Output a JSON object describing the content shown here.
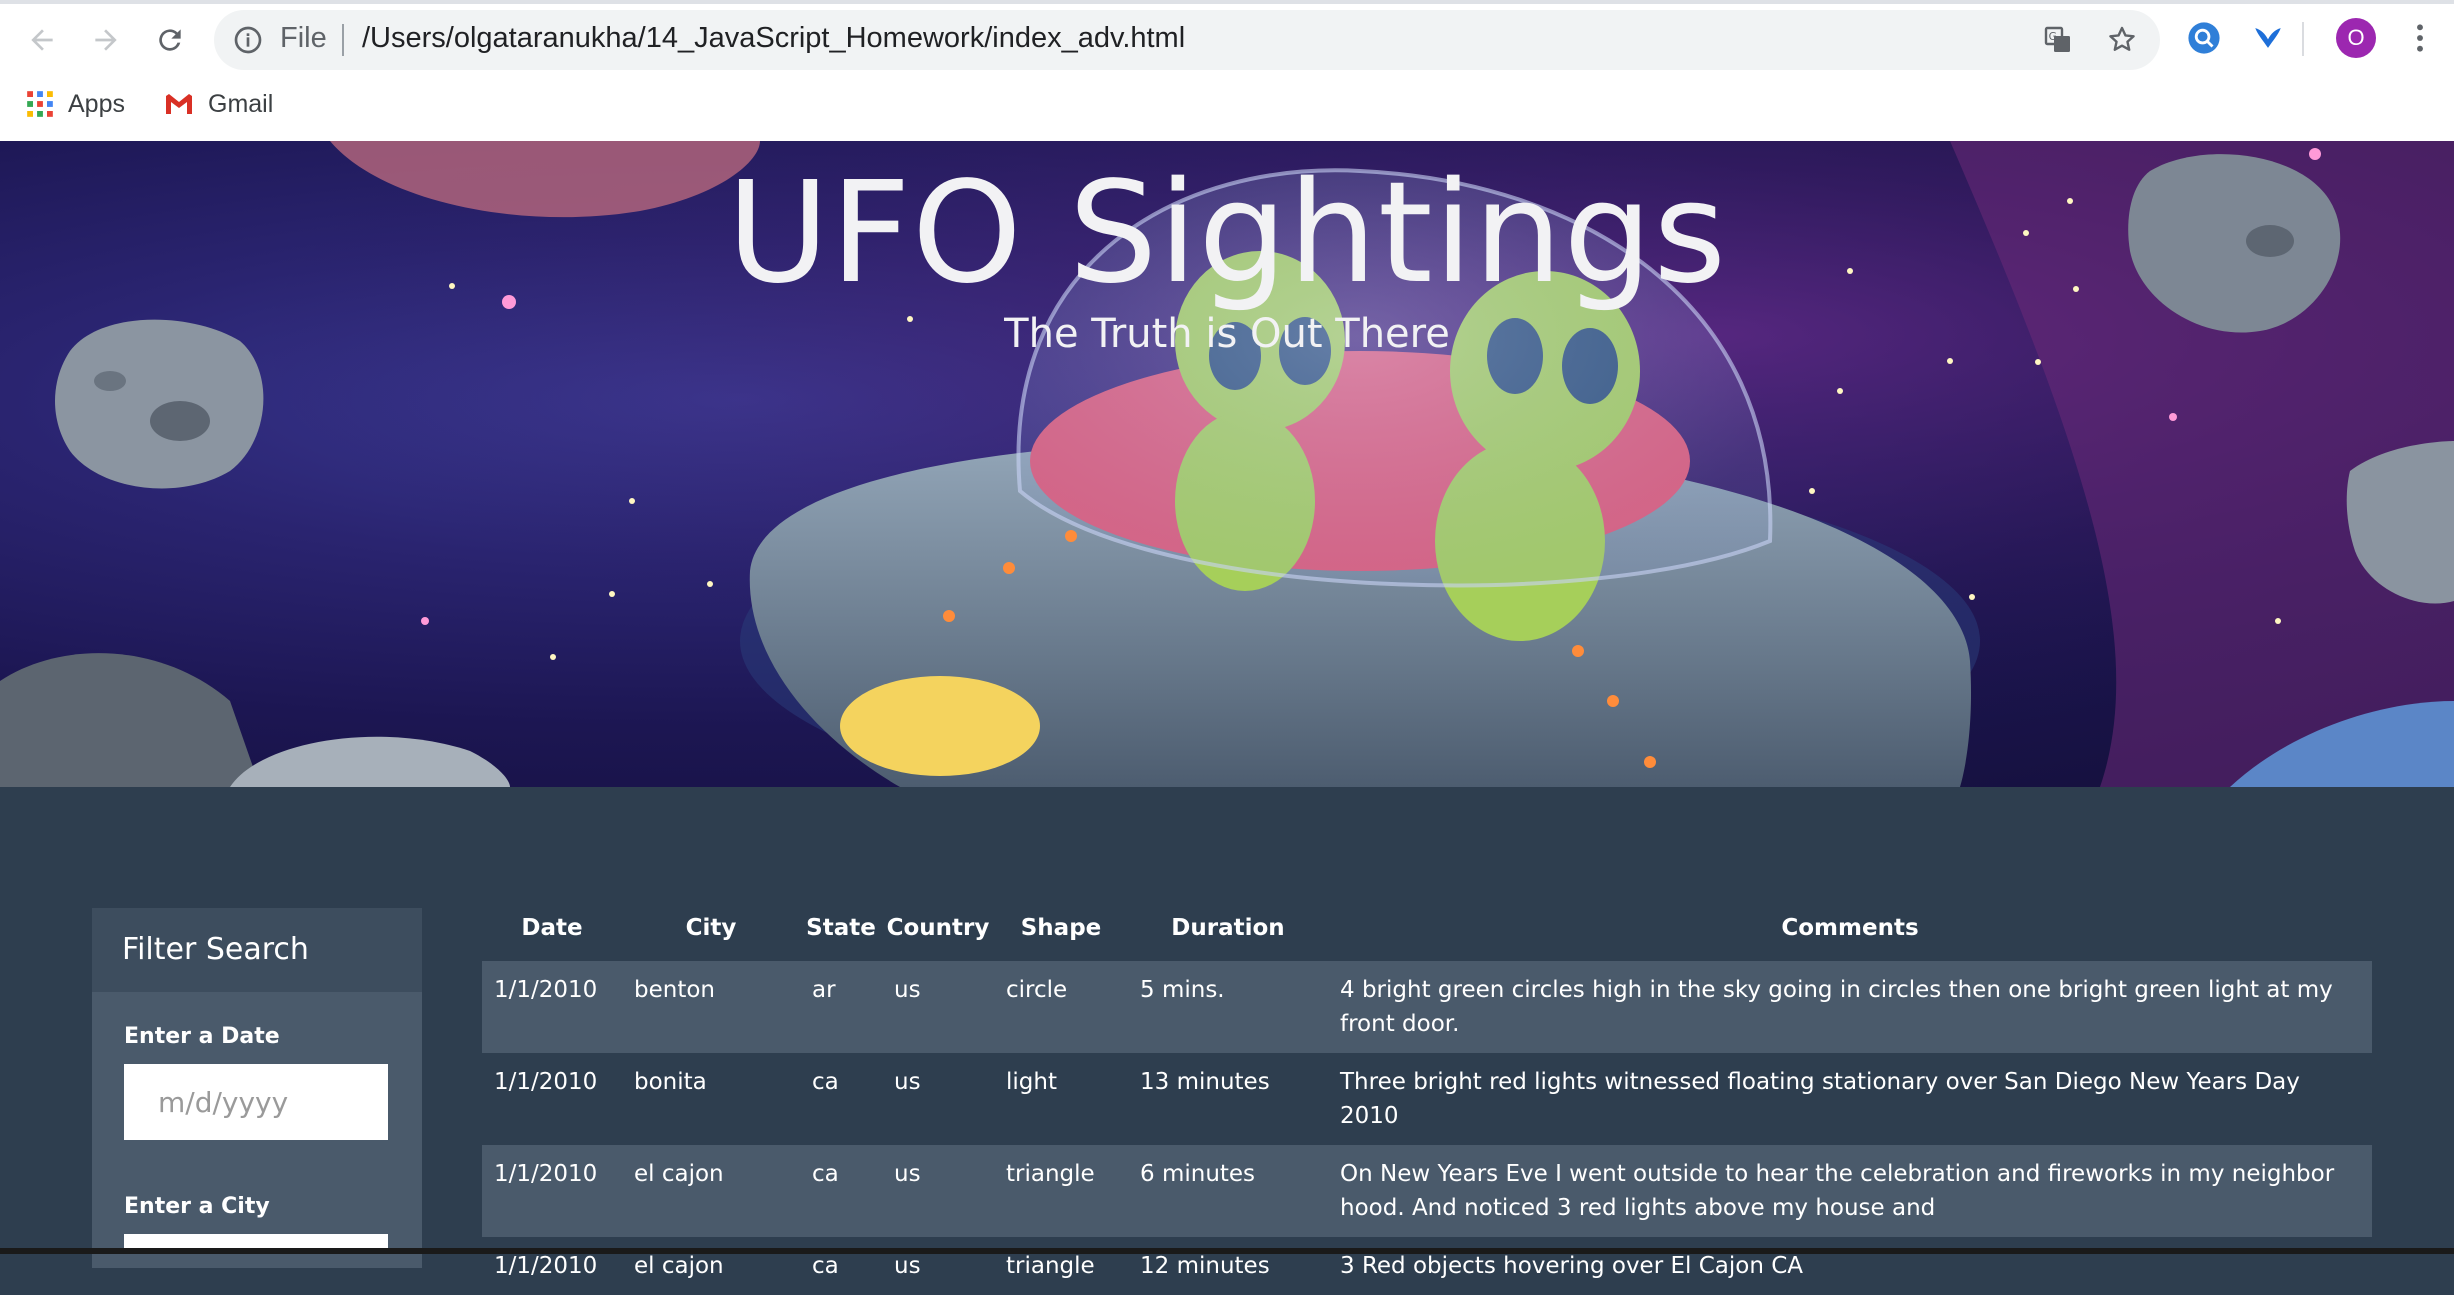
{
  "browser": {
    "file_label": "File",
    "url": "/Users/olgataranukha/14_JavaScript_Homework/index_adv.html",
    "profile_initial": "O",
    "bookmarks": [
      {
        "label": "Apps",
        "icon": "apps-grid-icon"
      },
      {
        "label": "Gmail",
        "icon": "gmail-icon"
      }
    ]
  },
  "hero": {
    "title": "UFO Sightings",
    "subtitle": "The Truth is Out There"
  },
  "filter": {
    "heading": "Filter Search",
    "date_label": "Enter a Date",
    "date_placeholder": "m/d/yyyy",
    "city_label": "Enter a City"
  },
  "table": {
    "headers": [
      "Date",
      "City",
      "State",
      "Country",
      "Shape",
      "Duration",
      "Comments"
    ],
    "rows": [
      [
        "1/1/2010",
        "benton",
        "ar",
        "us",
        "circle",
        "5 mins.",
        "4 bright green circles high in the sky going in circles then one bright green light at my front door."
      ],
      [
        "1/1/2010",
        "bonita",
        "ca",
        "us",
        "light",
        "13 minutes",
        "Three bright red lights witnessed floating stationary over San Diego New Years Day 2010"
      ],
      [
        "1/1/2010",
        "el cajon",
        "ca",
        "us",
        "triangle",
        "6 minutes",
        "On New Years Eve I went outside to hear the celebration and fireworks in my neighbor hood. And noticed 3 red lights above my house and"
      ],
      [
        "1/1/2010",
        "el cajon",
        "ca",
        "us",
        "triangle",
        "12 minutes",
        "3 Red objects hovering over El Cajon CA"
      ]
    ]
  }
}
